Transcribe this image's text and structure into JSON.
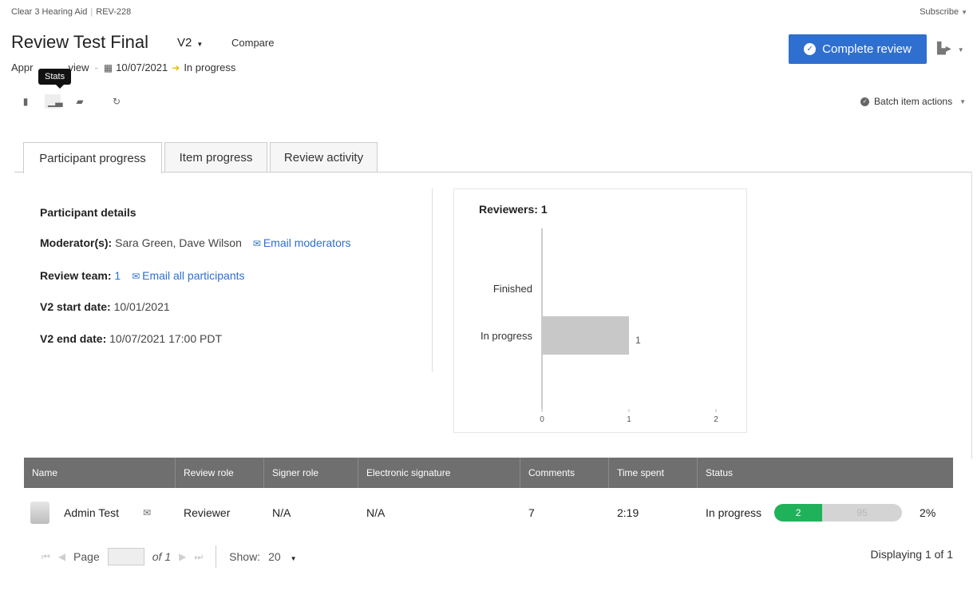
{
  "breadcrumb": {
    "project": "Clear 3 Hearing Aid",
    "id": "REV-228"
  },
  "subscribe_label": "Subscribe",
  "review": {
    "title": "Review Test Final",
    "version": "V2",
    "compare_label": "Compare",
    "type_prefix": "Appr",
    "type_suffix": "view",
    "date": "10/07/2021",
    "status": "In progress"
  },
  "tooltip": "Stats",
  "complete_button_label": "Complete review",
  "batch_actions_label": "Batch item actions",
  "icons": [
    "document-icon",
    "stats-icon",
    "comment-icon",
    "refresh-icon"
  ],
  "tabs": [
    {
      "label": "Participant progress",
      "active": true
    },
    {
      "label": "Item progress",
      "active": false
    },
    {
      "label": "Review activity",
      "active": false
    }
  ],
  "participant": {
    "heading": "Participant details",
    "moderators_label": "Moderator(s):",
    "moderators_value": "Sara Green, Dave Wilson",
    "email_moderators": "Email moderators",
    "team_label": "Review team:",
    "team_value": "1",
    "email_participants": "Email all participants",
    "start_label": "V2 start date:",
    "start_value": "10/01/2021",
    "end_label": "V2 end date:",
    "end_value": "10/07/2021 17:00 PDT"
  },
  "chart_data": {
    "type": "bar",
    "orientation": "horizontal",
    "title": "Reviewers: 1",
    "categories": [
      "Finished",
      "In progress"
    ],
    "values": [
      0,
      1
    ],
    "data_labels": [
      "",
      "1"
    ],
    "xlim": [
      0,
      2
    ],
    "x_ticks": [
      "0",
      "1",
      "2"
    ],
    "bar_color": "#c8c8c8"
  },
  "table": {
    "columns": [
      "Name",
      "Review role",
      "Signer role",
      "Electronic signature",
      "Comments",
      "Time spent",
      "Status"
    ],
    "rows": [
      {
        "name": "Admin Test",
        "review_role": "Reviewer",
        "signer_role": "N/A",
        "esignature": "N/A",
        "comments": "7",
        "time_spent": "2:19",
        "status": "In progress",
        "progress_done": "2",
        "progress_rest": "95",
        "progress_pct": "2%"
      }
    ]
  },
  "pager": {
    "page_label": "Page",
    "of_label": "of 1",
    "show_label": "Show:",
    "show_value": "20",
    "displaying": "Displaying 1 of 1"
  },
  "colors": {
    "primary": "#2f6fcf",
    "success": "#1fb25a",
    "header_gray": "#6f6f6f"
  }
}
